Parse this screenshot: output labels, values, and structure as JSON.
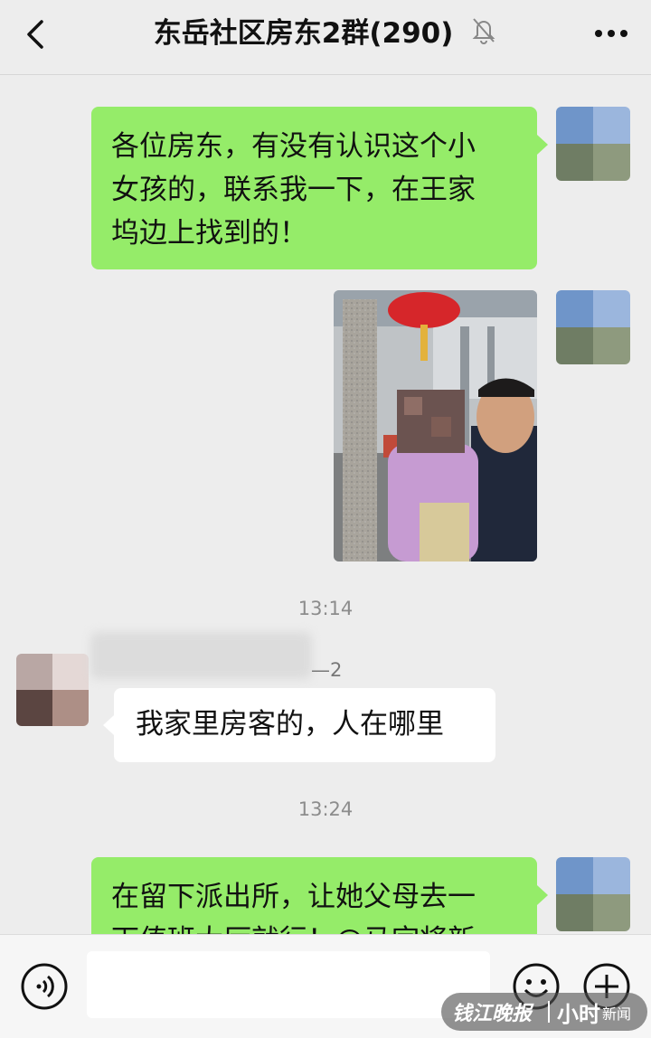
{
  "header": {
    "title": "东岳社区房东2群(290)",
    "back_icon": "chevron-left-icon",
    "mute_icon": "bell-slash-icon",
    "more_icon": "ellipsis-icon"
  },
  "messages": [
    {
      "type": "text",
      "side": "right",
      "lines": [
        "各位房东，有没有认识这个小",
        "女孩的，联系我一下，在王家",
        "坞边上找到的！"
      ]
    },
    {
      "type": "image",
      "side": "right"
    },
    {
      "type": "timestamp",
      "text": "13:14"
    },
    {
      "type": "text",
      "side": "left",
      "sender_suffix": "—2",
      "text": "我家里房客的，人在哪里"
    },
    {
      "type": "timestamp",
      "text": "13:24"
    },
    {
      "type": "text",
      "side": "right",
      "lines": [
        "在留下派出所，让她父母去一",
        "下值班大厅就行！@马宗将新"
      ]
    }
  ],
  "input_bar": {
    "placeholder": "",
    "voice_icon": "voice-icon",
    "emoji_icon": "emoji-icon",
    "plus_icon": "plus-circle-icon"
  },
  "watermark": {
    "brand": "钱江晚报",
    "brand2": "小时",
    "news": "新闻"
  },
  "colors": {
    "background": "#ededed",
    "bubble_sent": "#95ec69",
    "bubble_received": "#ffffff",
    "timestamp": "#8c8c8c"
  }
}
